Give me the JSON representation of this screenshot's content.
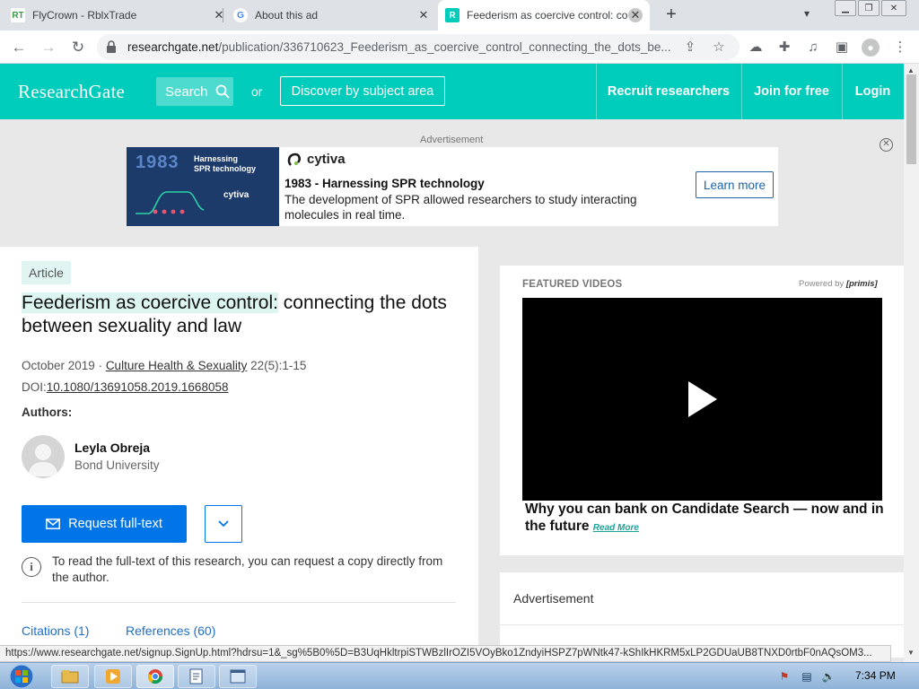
{
  "browser": {
    "tabs": [
      {
        "title": "FlyCrown - RblxTrade",
        "favicon": "RT"
      },
      {
        "title": "About this ad",
        "favicon": "G"
      },
      {
        "title": "Feederism as coercive control: co",
        "favicon": "R"
      }
    ],
    "url_host": "researchgate.net",
    "url_path": "/publication/336710623_Feederism_as_coercive_control_connecting_the_dots_be..."
  },
  "header": {
    "logo": "ResearchGate",
    "search_label": "Search",
    "or_text": "or",
    "discover_label": "Discover by subject area",
    "recruit_label": "Recruit researchers",
    "join_label": "Join for free",
    "login_label": "Login"
  },
  "ad": {
    "label": "Advertisement",
    "image_year": "1983",
    "image_headline_1": "Harnessing",
    "image_headline_2": "SPR technology",
    "image_brand": "cytiva",
    "brand": "cytiva",
    "title": "1983 - Harnessing SPR technology",
    "description": "The development of SPR allowed researchers to study interacting molecules in real time.",
    "cta": "Learn more"
  },
  "article": {
    "badge": "Article",
    "title_highlight": "Feederism as coercive control:",
    "title_rest": " connecting the dots between sexuality and law",
    "date": "October 2019",
    "separator": " · ",
    "journal": "Culture Health & Sexuality",
    "volume": " 22(5):1-15",
    "doi_prefix": "DOI:",
    "doi": "10.1080/13691058.2019.1668058",
    "authors_label": "Authors:",
    "author_name": "Leyla Obreja",
    "author_affiliation": "Bond University",
    "request_label": "Request full-text",
    "info_text": "To read the full-text of this research, you can request a copy directly from the author.",
    "citations_label": "Citations (1)",
    "references_label": "References (60)"
  },
  "featured": {
    "label": "FEATURED VIDEOS",
    "powered_by": "Powered by ",
    "powered_brand": "[primis]",
    "caption": "Why you can bank on Candidate Search — now and in the future ",
    "read_more": "Read More"
  },
  "ad2": {
    "label": "Advertisement"
  },
  "status_url": "https://www.researchgate.net/signup.SignUp.html?hdrsu=1&_sg%5B0%5D=B3UqHkltrpiSTWBzlIrOZI5VOyBko1ZndyiHSPZ7pWNtk47-kShIkHKRM5xLP2GDUaUB8TNXD0rtbF0nAQsOM3...",
  "taskbar": {
    "clock": "7:34 PM"
  },
  "colors": {
    "brand": "#00ccbb",
    "primary_button": "#0075e8",
    "link": "#1f6fc5"
  }
}
